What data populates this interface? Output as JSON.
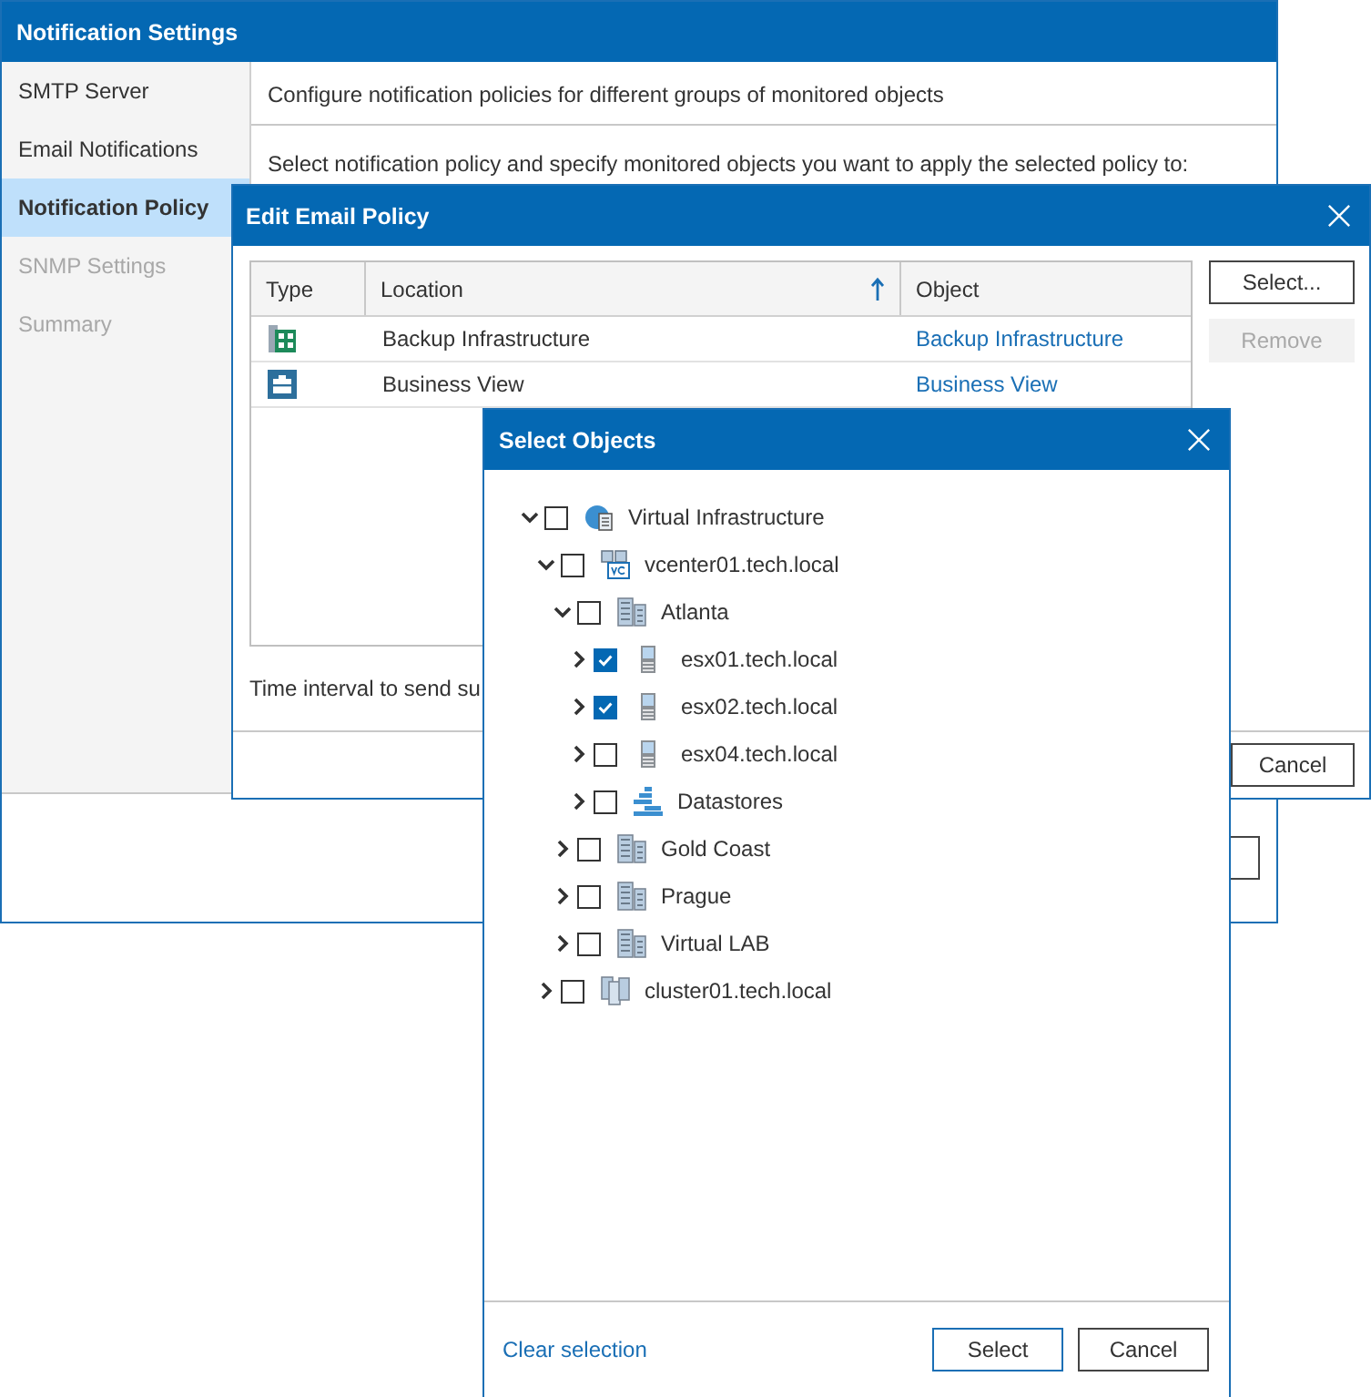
{
  "settings_window": {
    "title": "Notification Settings",
    "sidebar": {
      "items": [
        {
          "label": "SMTP Server",
          "selected": false,
          "disabled": false
        },
        {
          "label": "Email Notifications",
          "selected": false,
          "disabled": false
        },
        {
          "label": "Notification Policy",
          "selected": true,
          "disabled": false
        },
        {
          "label": "SNMP Settings",
          "selected": false,
          "disabled": true
        },
        {
          "label": "Summary",
          "selected": false,
          "disabled": true
        }
      ]
    },
    "description": "Configure notification policies for different groups of monitored objects",
    "instruction": "Select notification policy and specify monitored objects you want to apply the selected policy to:"
  },
  "edit_window": {
    "title": "Edit Email Policy",
    "table": {
      "columns": [
        {
          "label": "Type",
          "sorted": false
        },
        {
          "label": "Location",
          "sorted": true
        },
        {
          "label": "Object",
          "sorted": false
        }
      ],
      "rows": [
        {
          "kind": "infrastructure",
          "location": "Backup Infrastructure",
          "object": "Backup Infrastructure"
        },
        {
          "kind": "business",
          "location": "Business View",
          "object": "Business View"
        }
      ]
    },
    "buttons": [
      {
        "label": "Select...",
        "disabled": false
      },
      {
        "label": "Remove",
        "disabled": true
      }
    ],
    "interval_label": "Time interval to send su",
    "footer_buttons": [
      "Cancel"
    ]
  },
  "select_window": {
    "title": "Select Objects",
    "tree": [
      {
        "label": "Virtual Infrastructure",
        "kind": "globe",
        "expanded": true,
        "checked": false,
        "children": [
          {
            "label": "vcenter01.tech.local",
            "kind": "vcenter",
            "expanded": true,
            "checked": false,
            "children": [
              {
                "label": "Atlanta",
                "kind": "datacenter",
                "expanded": true,
                "checked": false,
                "children": [
                  {
                    "label": "esx01.tech.local",
                    "kind": "host",
                    "expanded": false,
                    "checked": true
                  },
                  {
                    "label": "esx02.tech.local",
                    "kind": "host",
                    "expanded": false,
                    "checked": true
                  },
                  {
                    "label": "esx04.tech.local",
                    "kind": "host",
                    "expanded": false,
                    "checked": false
                  },
                  {
                    "label": "Datastores",
                    "kind": "datastore",
                    "expanded": false,
                    "checked": false
                  }
                ]
              },
              {
                "label": "Gold Coast",
                "kind": "datacenter",
                "expanded": false,
                "checked": false
              },
              {
                "label": "Prague",
                "kind": "datacenter",
                "expanded": false,
                "checked": false
              },
              {
                "label": "Virtual LAB",
                "kind": "datacenter",
                "expanded": false,
                "checked": false
              }
            ]
          },
          {
            "label": "cluster01.tech.local",
            "kind": "cluster",
            "expanded": false,
            "checked": false
          }
        ]
      }
    ],
    "clear_link": "Clear selection",
    "buttons": [
      {
        "label": "Select",
        "default": true
      },
      {
        "label": "Cancel",
        "default": false
      }
    ]
  }
}
